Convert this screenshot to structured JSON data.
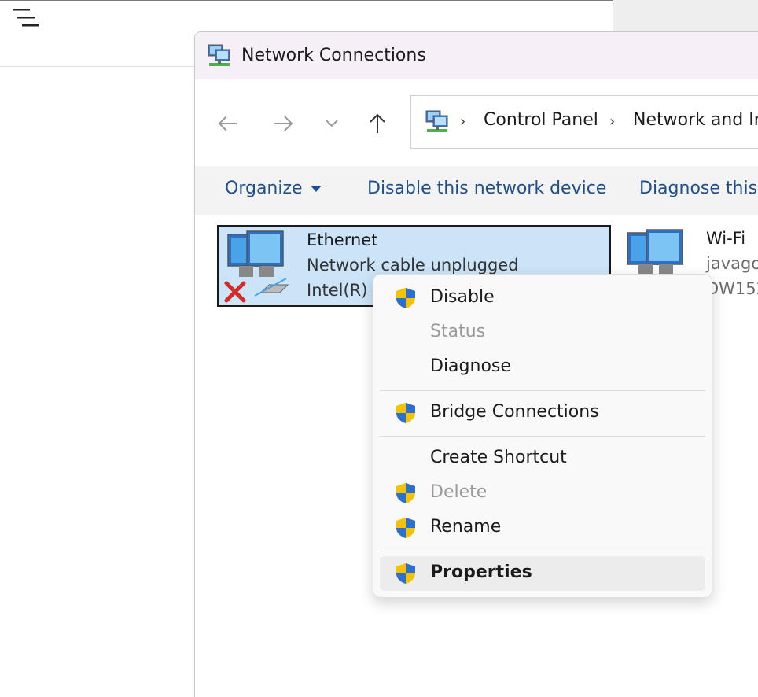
{
  "window": {
    "title": "Network Connections"
  },
  "address_bar": {
    "breadcrumbs": [
      "Control Panel",
      "Network and In"
    ]
  },
  "command_bar": {
    "organize": "Organize",
    "disable_device": "Disable this network device",
    "diagnose": "Diagnose this c"
  },
  "connections": [
    {
      "name": "Ethernet",
      "status": "Network cable unplugged",
      "device": "Intel(R)"
    },
    {
      "name": "Wi-Fi",
      "status": "javago",
      "device": "DW152"
    }
  ],
  "context_menu": {
    "items": [
      {
        "label": "Disable",
        "shield": true,
        "enabled": true
      },
      {
        "label": "Status",
        "shield": false,
        "enabled": false
      },
      {
        "label": "Diagnose",
        "shield": false,
        "enabled": true
      },
      {
        "label": "Bridge Connections",
        "shield": true,
        "enabled": true
      },
      {
        "label": "Create Shortcut",
        "shield": false,
        "enabled": true
      },
      {
        "label": "Delete",
        "shield": true,
        "enabled": false
      },
      {
        "label": "Rename",
        "shield": true,
        "enabled": true
      },
      {
        "label": "Properties",
        "shield": true,
        "enabled": true,
        "default": true
      }
    ]
  },
  "icons": {
    "hamburger": "hamburger-menu-icon",
    "back": "back-arrow-icon",
    "forward": "forward-arrow-icon",
    "recent": "chevron-down-icon",
    "up": "up-arrow-icon",
    "network_folder": "network-connections-icon",
    "uac_shield": "uac-shield-icon"
  },
  "colors": {
    "selection": "#cce4f7",
    "command_link": "#1f4e8c",
    "titlebar": "#f7eff7",
    "disabled_text": "#9a9a9a"
  }
}
